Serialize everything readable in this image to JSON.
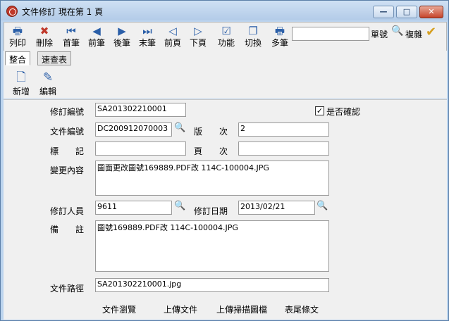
{
  "window": {
    "title": "文件修訂  現在第 1 頁"
  },
  "controls": {
    "minimize": "—",
    "maximize": "□",
    "close": "✕"
  },
  "toolbar": {
    "items": [
      {
        "label": "列印",
        "icon": "printer-icon",
        "glyph": "🖶"
      },
      {
        "label": "刪除",
        "icon": "delete-icon",
        "glyph": "✖"
      },
      {
        "label": "首筆",
        "icon": "first-record-icon",
        "glyph": "⏮"
      },
      {
        "label": "前筆",
        "icon": "prev-record-icon",
        "glyph": "◀"
      },
      {
        "label": "後筆",
        "icon": "next-record-icon",
        "glyph": "▶"
      },
      {
        "label": "末筆",
        "icon": "last-record-icon",
        "glyph": "⏭"
      },
      {
        "label": "前頁",
        "icon": "prev-page-icon",
        "glyph": "◁"
      },
      {
        "label": "下頁",
        "icon": "next-page-icon",
        "glyph": "▷"
      },
      {
        "label": "功能",
        "icon": "function-icon",
        "glyph": "☑"
      },
      {
        "label": "切換",
        "icon": "switch-icon",
        "glyph": "❐"
      },
      {
        "label": "多筆",
        "icon": "multi-record-icon",
        "glyph": "🖶"
      }
    ],
    "search": {
      "value": "",
      "label": "單號",
      "copy_label": "複雜"
    }
  },
  "tabs": [
    {
      "label": "整合"
    },
    {
      "label": "速查表"
    }
  ],
  "subtoolbar": [
    {
      "label": "新增",
      "icon": "new-doc-icon",
      "glyph": "🗋"
    },
    {
      "label": "編輯",
      "icon": "edit-doc-icon",
      "glyph": "✎"
    }
  ],
  "form": {
    "revision_no": {
      "label": "修訂編號",
      "value": "SA201302210001"
    },
    "confirmed": {
      "label": "是否確認",
      "checked": "✓"
    },
    "doc_no": {
      "label": "文件編號",
      "value": "DC200912070003"
    },
    "version": {
      "label": "版　　次",
      "value": "2"
    },
    "mark": {
      "label": "標　　記",
      "value": ""
    },
    "page_no": {
      "label": "頁　　次",
      "value": ""
    },
    "change_content": {
      "label": "變更內容",
      "value": "圖面更改圖號169889.PDF改 114C-100004.JPG"
    },
    "reviser": {
      "label": "修訂人員",
      "value": "9611"
    },
    "revise_date": {
      "label": "修訂日期",
      "value": "2013/02/21"
    },
    "remark": {
      "label": "備　　註",
      "value": "圖號169889.PDF改 114C-100004.JPG"
    },
    "file_path": {
      "label": "文件路徑",
      "value": "SA201302210001.jpg"
    },
    "footer_links": [
      "文件瀏覽",
      "上傳文件",
      "上傳掃描圖檔",
      "表尾條文"
    ]
  }
}
